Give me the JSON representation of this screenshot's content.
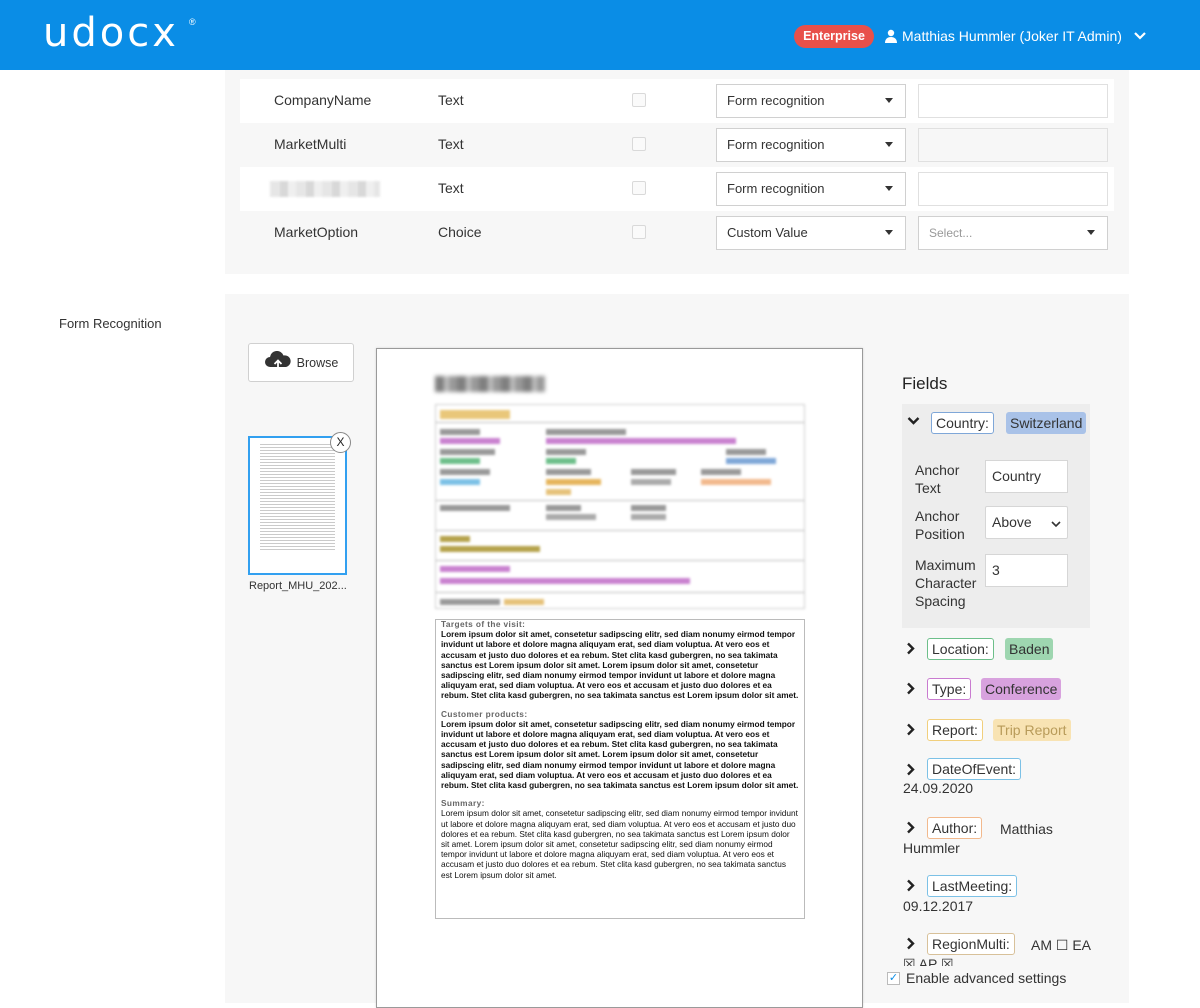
{
  "header": {
    "logo_text": "udocx",
    "logo_registered": "®",
    "plan_badge": "Enterprise",
    "user_name": "Matthias Hummler (Joker IT Admin)",
    "brand_color": "#0a8de6",
    "badge_color": "#e8504a"
  },
  "field_rows": [
    {
      "name": "CompanyName",
      "type": "Text",
      "method": "Form recognition",
      "value": ""
    },
    {
      "name": "MarketMulti",
      "type": "Text",
      "method": "Form recognition",
      "value": ""
    },
    {
      "name": "",
      "type": "Text",
      "method": "Form recognition",
      "value": ""
    },
    {
      "name": "MarketOption",
      "type": "Choice",
      "method": "Custom Value",
      "value_placeholder": "Select..."
    }
  ],
  "form_recognition": {
    "section_label": "Form Recognition",
    "browse_label": "Browse",
    "close_label": "X",
    "file_name": "Report_MHU_202..."
  },
  "document": {
    "heading_1": "Targets of the visit:",
    "body_1": "Lorem ipsum dolor sit amet, consetetur sadipscing elitr, sed diam nonumy eirmod tempor invidunt ut labore et dolore magna aliquyam erat, sed diam voluptua. At vero eos et accusam et justo duo dolores et ea rebum. Stet clita kasd gubergren, no sea takimata sanctus est Lorem ipsum dolor sit amet. Lorem ipsum dolor sit amet, consetetur sadipscing elitr, sed diam nonumy eirmod tempor invidunt ut labore et dolore magna aliquyam erat, sed diam voluptua. At vero eos et accusam et justo duo dolores et ea rebum. Stet clita kasd gubergren, no sea takimata sanctus est Lorem ipsum dolor sit amet.",
    "heading_2": "Customer products:",
    "body_2": "Lorem ipsum dolor sit amet, consetetur sadipscing elitr, sed diam nonumy eirmod tempor invidunt ut labore et dolore magna aliquyam erat, sed diam voluptua. At vero eos et accusam et justo duo dolores et ea rebum. Stet clita kasd gubergren, no sea takimata sanctus est Lorem ipsum dolor sit amet. Lorem ipsum dolor sit amet, consetetur sadipscing elitr, sed diam nonumy eirmod tempor invidunt ut labore et dolore magna aliquyam erat, sed diam voluptua. At vero eos et accusam et justo duo dolores et ea rebum. Stet clita kasd gubergren, no sea takimata sanctus est Lorem ipsum dolor sit amet.",
    "heading_3": "Summary:",
    "body_3": "Lorem ipsum dolor sit amet, consetetur sadipscing elitr, sed diam nonumy eirmod tempor invidunt ut labore et dolore magna aliquyam erat, sed diam voluptua. At vero eos et accusam et justo duo dolores et ea rebum. Stet clita kasd gubergren, no sea takimata sanctus est Lorem ipsum dolor sit amet. Lorem ipsum dolor sit amet, consetetur sadipscing elitr, sed diam nonumy eirmod tempor invidunt ut labore et dolore magna aliquyam erat, sed diam voluptua. At vero eos et accusam et justo duo dolores et ea rebum. Stet clita kasd gubergren, no sea takimata sanctus est Lorem ipsum dolor sit amet."
  },
  "fields_panel": {
    "title": "Fields",
    "country": {
      "label": "Country:",
      "value": "Switzerland",
      "anchor_text_label": "Anchor Text",
      "anchor_text_value": "Country",
      "anchor_position_label": "Anchor Position",
      "anchor_position_value": "Above",
      "max_spacing_label": "Maximum Character Spacing",
      "max_spacing_value": "3"
    },
    "location": {
      "label": "Location:",
      "value": "Baden"
    },
    "type": {
      "label": "Type:",
      "value": "Conference"
    },
    "report": {
      "label": "Report:",
      "value": "Trip Report"
    },
    "date_of_event": {
      "label": "DateOfEvent:",
      "value": "24.09.2020"
    },
    "author": {
      "label": "Author:",
      "value": "Matthias Hummler"
    },
    "last_meeting": {
      "label": "LastMeeting:",
      "value": "09.12.2017"
    },
    "region_multi": {
      "label": "RegionMulti:",
      "value": "AM ☐ EA ☒ AP ☒"
    },
    "colors": {
      "country": "#7fa7d8",
      "location": "#6dbf8a",
      "type": "#c97bd0",
      "report": "#f1cf7c",
      "date": "#7cc1e6",
      "author": "#f2b98d",
      "last": "#7cc1e6",
      "region": "#d8c19a"
    },
    "advanced_label": "Enable advanced settings",
    "advanced_checked": true
  }
}
